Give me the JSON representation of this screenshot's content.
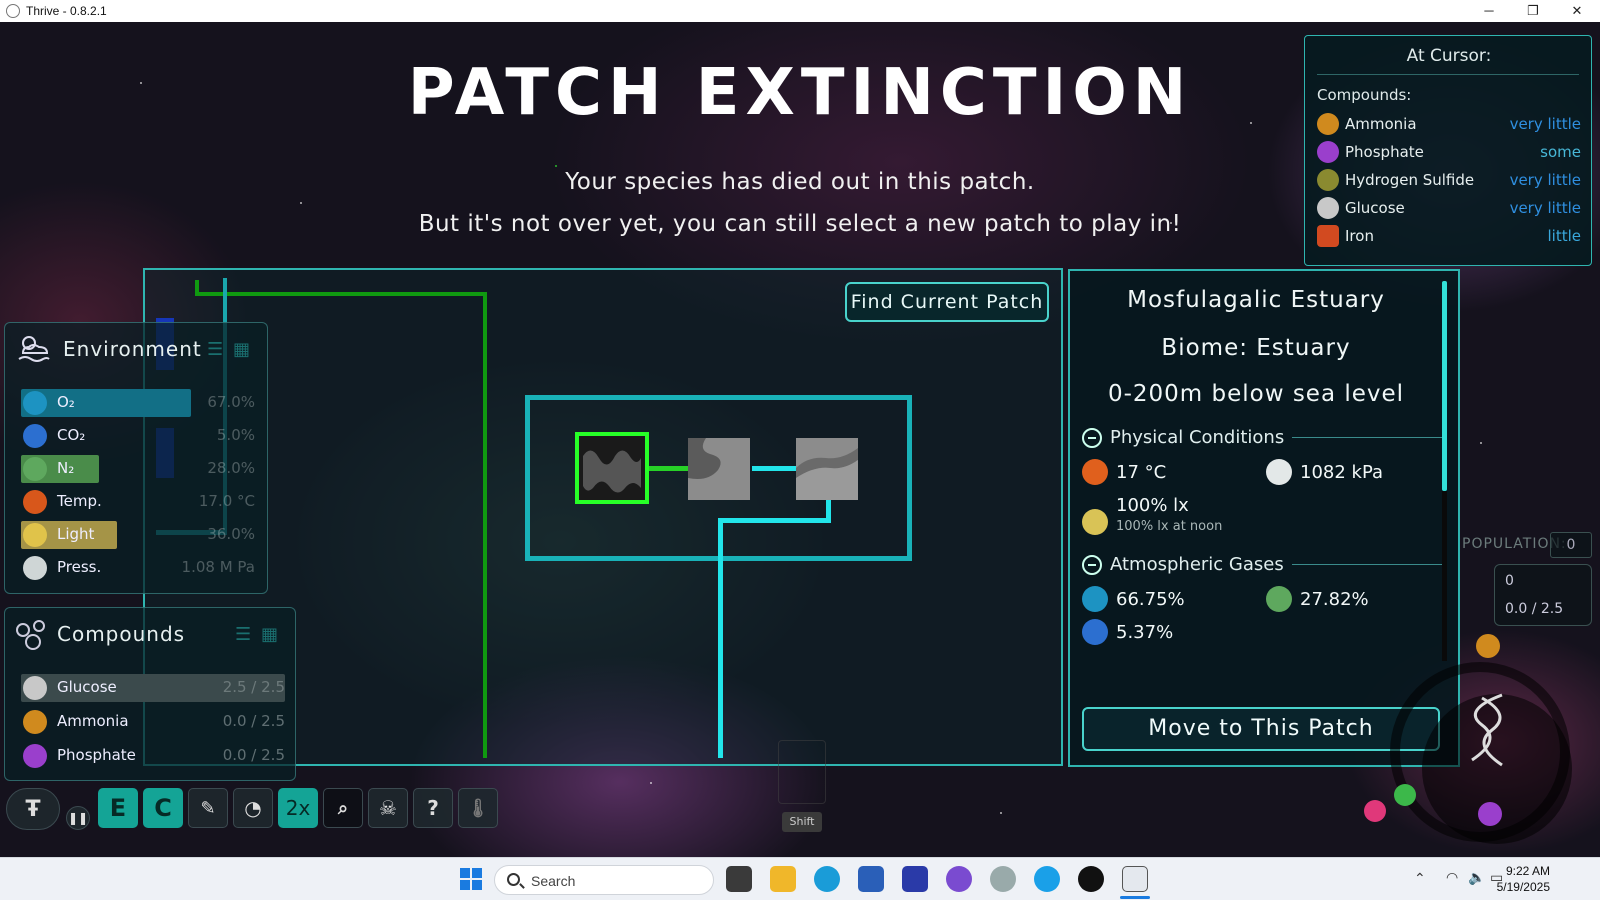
{
  "window": {
    "title": "Thrive - 0.8.2.1",
    "minimize": "─",
    "maximize": "❐",
    "close": "✕"
  },
  "heading": {
    "title": "PATCH EXTINCTION",
    "line1": "Your species has died out in this patch.",
    "line2": "But it's not over yet, you can still select a new patch to play in!"
  },
  "map": {
    "find_current_patch": "Find Current Patch"
  },
  "environment": {
    "title": "Environment",
    "rows": [
      {
        "label": "O₂",
        "value": "67.0%",
        "color": "#1b7f98",
        "bar": 0.67
      },
      {
        "label": "CO₂",
        "value": "5.0%",
        "color": "#2c6fd0",
        "bar": 0.0
      },
      {
        "label": "N₂",
        "value": "28.0%",
        "color": "#4a8c4a",
        "bar": 0.28
      },
      {
        "label": "Temp.",
        "value": "17.0 °C",
        "color": "#d8571b",
        "bar": 0.0
      },
      {
        "label": "Light",
        "value": "36.0%",
        "color": "#a59447",
        "bar": 0.36
      },
      {
        "label": "Press.",
        "value": "1.08 M Pa",
        "color": "#cfd6d6",
        "bar": 0.0
      }
    ]
  },
  "compounds_panel": {
    "title": "Compounds",
    "rows": [
      {
        "label": "Glucose",
        "value": "2.5 / 2.5",
        "color": "#c8c8c8",
        "bar": 1.0
      },
      {
        "label": "Ammonia",
        "value": "0.0 / 2.5",
        "color": "#d08a1e",
        "bar": 0.0
      },
      {
        "label": "Phosphate",
        "value": "0.0 / 2.5",
        "color": "#9a3fcc",
        "bar": 0.0
      }
    ]
  },
  "patch_info": {
    "name": "Mosfulagalic Estuary",
    "biome": "Biome: Estuary",
    "depth": "0-200m below sea level",
    "physical_title": "Physical Conditions",
    "temperature": "17 °C",
    "pressure": "1082 kPa",
    "light": "100% lx",
    "light_noon": "100% lx at noon",
    "atmo_title": "Atmospheric Gases",
    "oxygen": "66.75%",
    "nitrogen": "27.82%",
    "co2": "5.37%",
    "move_button": "Move to This Patch"
  },
  "at_cursor": {
    "title": "At Cursor:",
    "compounds_label": "Compounds:",
    "rows": [
      {
        "name": "Ammonia",
        "amount": "very little",
        "color": "#d08a1e",
        "amount_color": "#2f8fe0"
      },
      {
        "name": "Phosphate",
        "amount": "some",
        "color": "#9a3fcc",
        "amount_color": "#48b8d8"
      },
      {
        "name": "Hydrogen Sulfide",
        "amount": "very little",
        "color": "#8a8a30",
        "amount_color": "#2f8fe0"
      },
      {
        "name": "Glucose",
        "amount": "very little",
        "color": "#c8c8c8",
        "amount_color": "#2f8fe0"
      },
      {
        "name": "Iron",
        "amount": "little",
        "color": "#d24a20",
        "amount_color": "#3aa8dc"
      }
    ]
  },
  "hud": {
    "population_label": "POPULATION:",
    "population_value": "0",
    "atp_value": "0",
    "atp_cap": "0.0 / 2.5",
    "shift_label": "Shift"
  },
  "toolbar": {
    "editor": "E",
    "compounds": "C",
    "speed": "2x",
    "help": "?"
  },
  "taskbar": {
    "search_placeholder": "Search",
    "time": "9:22 AM",
    "date": "5/19/2025"
  }
}
